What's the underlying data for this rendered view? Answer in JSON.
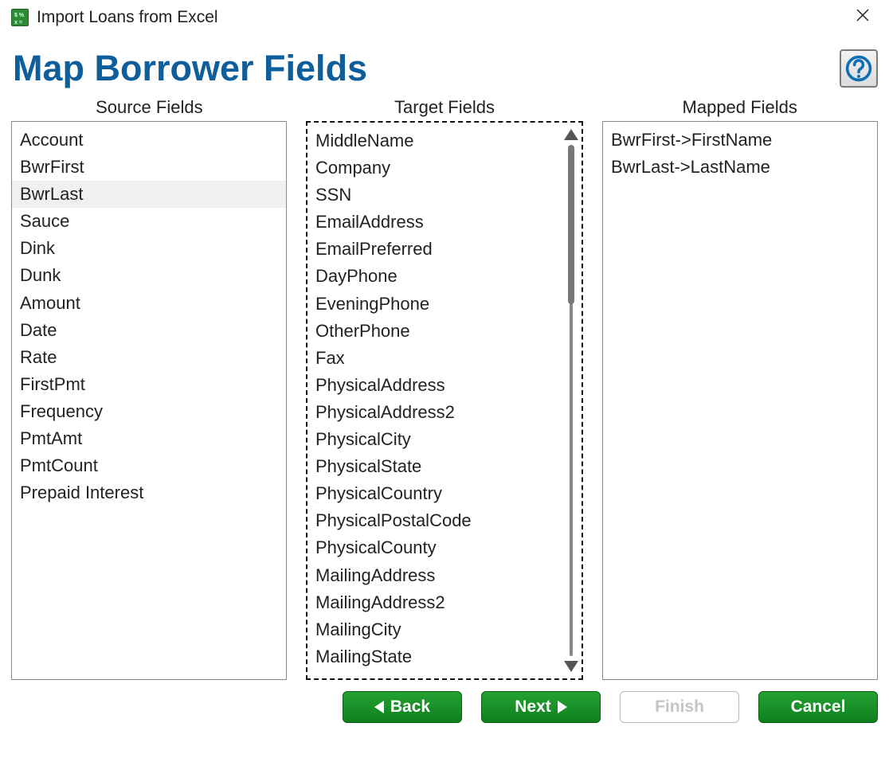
{
  "window": {
    "title": "Import Loans from Excel"
  },
  "page": {
    "title": "Map Borrower Fields"
  },
  "headers": {
    "source": "Source Fields",
    "target": "Target Fields",
    "mapped": "Mapped Fields"
  },
  "source_fields": {
    "items": [
      {
        "label": "Account",
        "selected": false
      },
      {
        "label": "BwrFirst",
        "selected": false
      },
      {
        "label": "BwrLast",
        "selected": true
      },
      {
        "label": "Sauce",
        "selected": false
      },
      {
        "label": "Dink",
        "selected": false
      },
      {
        "label": "Dunk",
        "selected": false
      },
      {
        "label": "Amount",
        "selected": false
      },
      {
        "label": "Date",
        "selected": false
      },
      {
        "label": "Rate",
        "selected": false
      },
      {
        "label": "FirstPmt",
        "selected": false
      },
      {
        "label": "Frequency",
        "selected": false
      },
      {
        "label": "PmtAmt",
        "selected": false
      },
      {
        "label": "PmtCount",
        "selected": false
      },
      {
        "label": "Prepaid Interest",
        "selected": false
      }
    ]
  },
  "target_fields": {
    "items": [
      {
        "label": "MiddleName"
      },
      {
        "label": "Company"
      },
      {
        "label": "SSN"
      },
      {
        "label": "EmailAddress"
      },
      {
        "label": "EmailPreferred"
      },
      {
        "label": "DayPhone"
      },
      {
        "label": "EveningPhone"
      },
      {
        "label": "OtherPhone"
      },
      {
        "label": "Fax"
      },
      {
        "label": "PhysicalAddress"
      },
      {
        "label": "PhysicalAddress2"
      },
      {
        "label": "PhysicalCity"
      },
      {
        "label": "PhysicalState"
      },
      {
        "label": "PhysicalCountry"
      },
      {
        "label": "PhysicalPostalCode"
      },
      {
        "label": "PhysicalCounty"
      },
      {
        "label": "MailingAddress"
      },
      {
        "label": "MailingAddress2"
      },
      {
        "label": "MailingCity"
      },
      {
        "label": "MailingState"
      }
    ]
  },
  "mapped_fields": {
    "items": [
      {
        "label": "BwrFirst->FirstName"
      },
      {
        "label": "BwrLast->LastName"
      }
    ]
  },
  "buttons": {
    "back": "Back",
    "next": "Next",
    "finish": "Finish",
    "cancel": "Cancel"
  },
  "icons": {
    "help": "help-icon",
    "close": "close-icon",
    "app": "app-icon"
  },
  "colors": {
    "title": "#0f5e9c",
    "button_green": "#1a8f26",
    "disabled_text": "#c5c5c5"
  }
}
